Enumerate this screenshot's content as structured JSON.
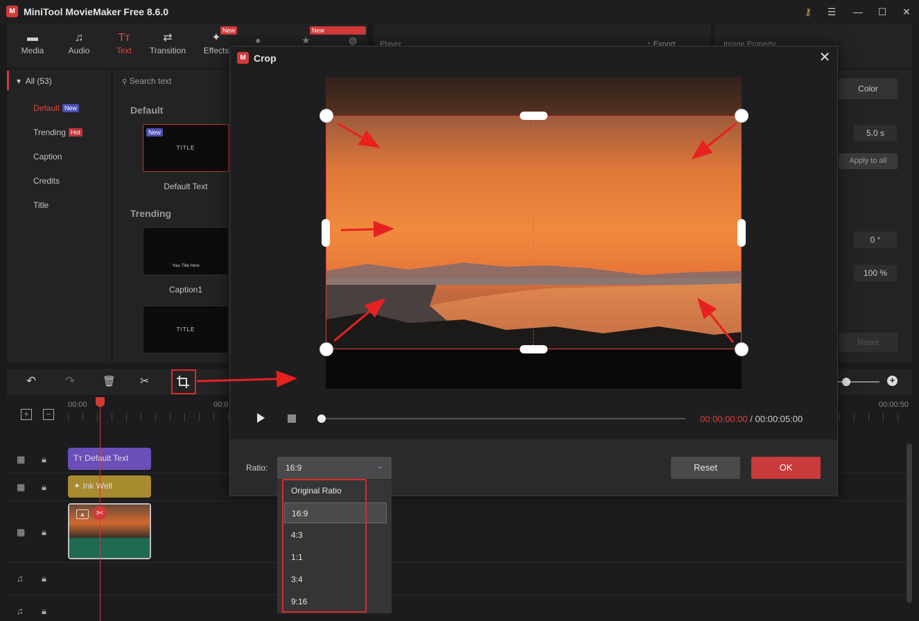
{
  "app": {
    "title": "MiniTool MovieMaker Free 8.6.0",
    "logo": "MiniTool logo"
  },
  "toolbar_tabs": [
    {
      "label": "Media",
      "icon": "folder-icon",
      "badge": ""
    },
    {
      "label": "Audio",
      "icon": "music-note-icon",
      "badge": ""
    },
    {
      "label": "Text",
      "icon": "text-icon",
      "badge": ""
    },
    {
      "label": "Transition",
      "icon": "swap-arrows-icon",
      "badge": ""
    },
    {
      "label": "Effects",
      "icon": "effects-icon",
      "badge": "New"
    }
  ],
  "hidden_tab_badge": "New",
  "player_panel_title": "Player",
  "export_label": "Export",
  "property_panel_title": "Image Property",
  "library": {
    "all_label": "All (53)",
    "search_placeholder": "Search text",
    "categories": [
      {
        "label": "Default",
        "badge": "New",
        "badge_type": "new"
      },
      {
        "label": "Trending",
        "badge": "Hot",
        "badge_type": "hot"
      },
      {
        "label": "Caption",
        "badge": ""
      },
      {
        "label": "Credits",
        "badge": ""
      },
      {
        "label": "Title",
        "badge": ""
      }
    ],
    "sections": [
      {
        "heading": "Default",
        "items": [
          {
            "thumb_text": "TITLE",
            "badge": "New",
            "caption": "Default Text"
          }
        ]
      },
      {
        "heading": "Trending",
        "items": [
          {
            "thumb_text": "Your Title Here",
            "caption": "Caption1"
          },
          {
            "thumb_text": "TITLE",
            "caption": ""
          }
        ]
      }
    ]
  },
  "properties": {
    "color_label": "Color",
    "duration": "5.0 s",
    "apply_all": "Apply to all",
    "rotation": "0 °",
    "scale": "100 %",
    "reset": "Reset"
  },
  "timeline": {
    "time_start": "00:00",
    "time_mid": "00:0",
    "time_end": "00:00:50",
    "clips": [
      {
        "label": "Default Text",
        "icon": "text-icon"
      },
      {
        "label": "Ink Well",
        "icon": "effects-icon"
      }
    ]
  },
  "crop_dialog": {
    "title": "Crop",
    "time_current": "00:00:00:00",
    "time_separator": " / ",
    "time_total": "00:00:05:00",
    "progress": 0,
    "ratio_label": "Ratio:",
    "ratio_selected": "16:9",
    "ratio_options": [
      "Original Ratio",
      "16:9",
      "4:3",
      "1:1",
      "3:4",
      "9:16"
    ],
    "reset_label": "Reset",
    "ok_label": "OK"
  },
  "colors": {
    "accent": "#d23a3a",
    "ok_button": "#c93a3a",
    "highlight": "#e03030"
  }
}
